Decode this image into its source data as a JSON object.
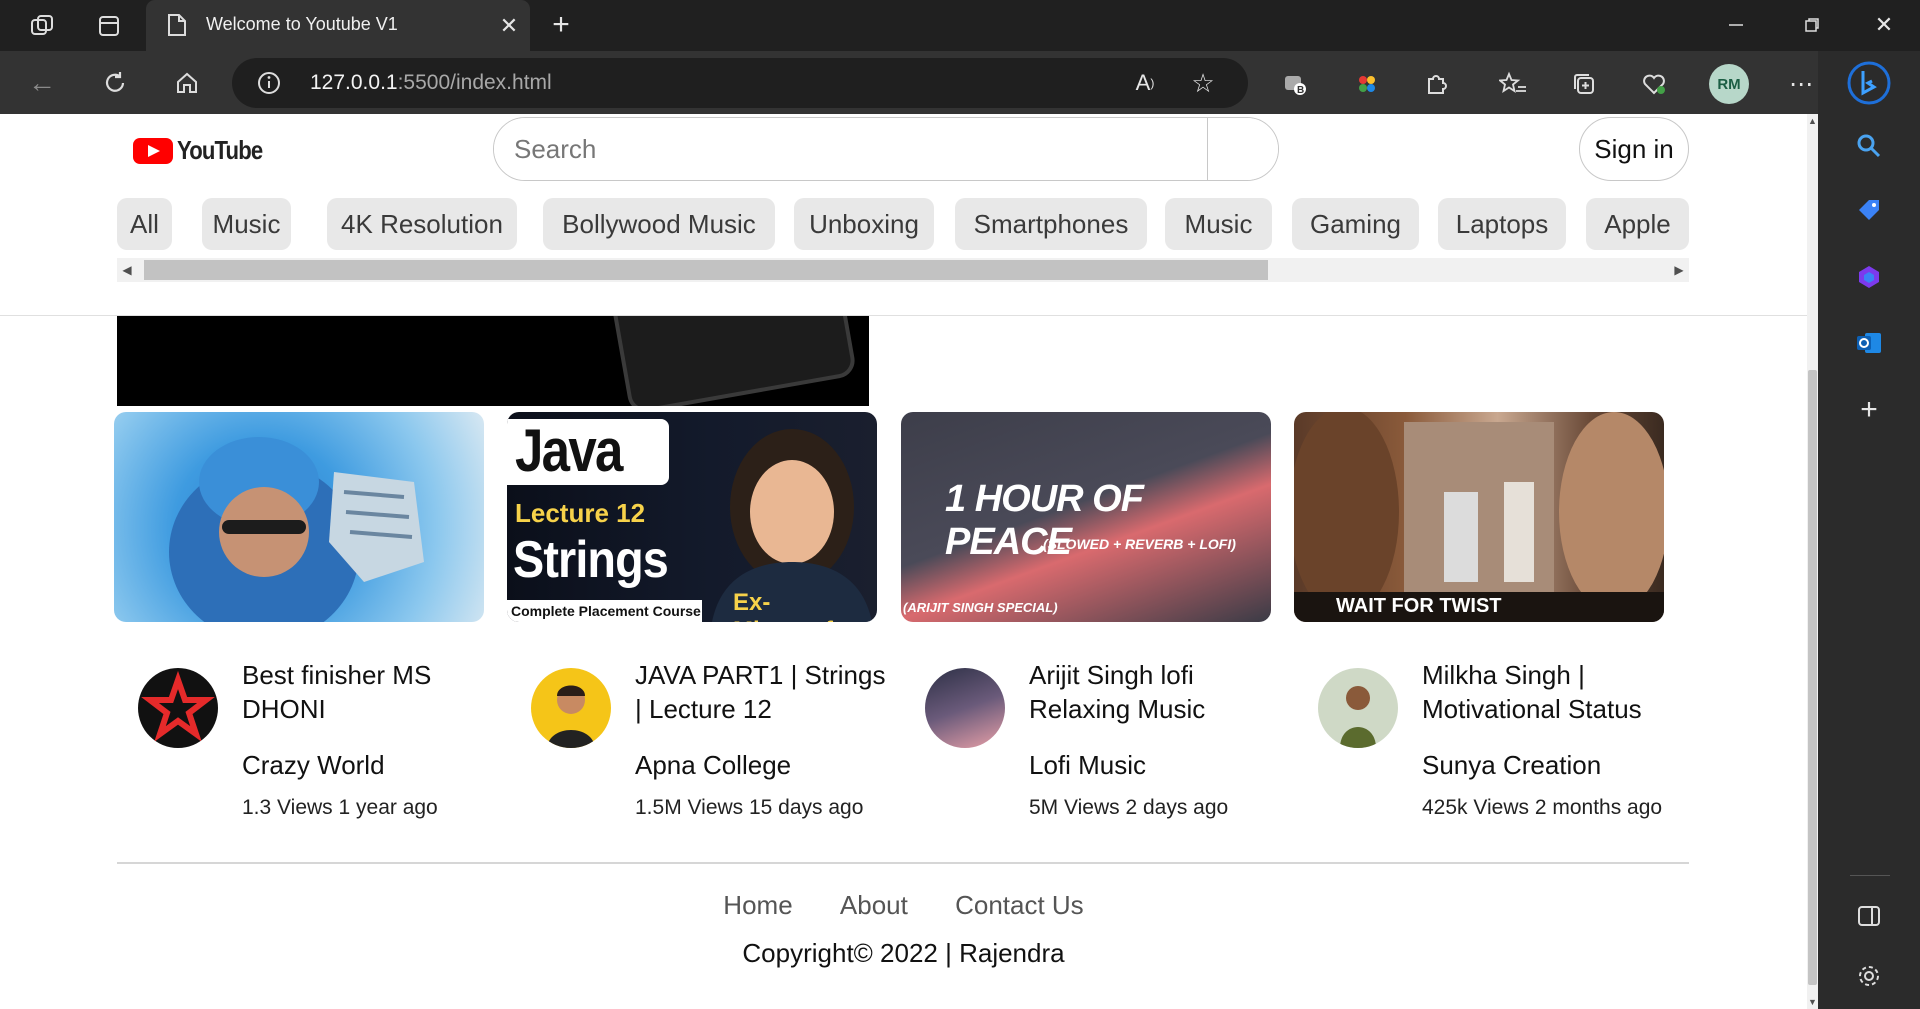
{
  "browser": {
    "tab_title": "Welcome to Youtube V1",
    "url_host": "127.0.0.1",
    "url_rest": ":5500/index.html",
    "profile_initials": "RM"
  },
  "header": {
    "logo_text": "YouTube",
    "search_placeholder": "Search",
    "signin_label": "Sign in"
  },
  "chips": [
    {
      "label": "All"
    },
    {
      "label": "Music"
    },
    {
      "label": "4K Resolution"
    },
    {
      "label": "Bollywood Music"
    },
    {
      "label": "Unboxing"
    },
    {
      "label": "Smartphones"
    },
    {
      "label": "Music"
    },
    {
      "label": "Gaming"
    },
    {
      "label": "Laptops"
    },
    {
      "label": "Apple"
    }
  ],
  "thumbnails": {
    "java_title": "Java",
    "java_lecture": "Lecture 12",
    "java_strings": "Strings",
    "java_course": "Complete Placement Course",
    "java_badge": "Ex-Microsoft",
    "lofi_title": "1 HOUR OF PEACE",
    "lofi_sub": "(SLOWED + REVERB + LOFI)",
    "lofi_tag": "(ARIJIT SINGH SPECIAL)",
    "milkha_text": "WAIT FOR TWIST"
  },
  "videos": [
    {
      "title": "Best finisher MS DHONI",
      "channel": "Crazy World",
      "stats": "1.3 Views 1 year ago"
    },
    {
      "title": "JAVA PART1 | Strings | Lecture 12",
      "channel": "Apna College",
      "stats": "1.5M Views 15 days ago"
    },
    {
      "title": "Arijit Singh lofi Relaxing Music",
      "channel": "Lofi Music",
      "stats": "5M Views 2 days ago"
    },
    {
      "title": "Milkha Singh | Motivational Status",
      "channel": "Sunya Creation",
      "stats": "425k Views 2 months ago"
    }
  ],
  "footer": {
    "links": [
      {
        "label": "Home"
      },
      {
        "label": "About"
      },
      {
        "label": "Contact Us"
      }
    ],
    "copyright": "Copyright© 2022 | Rajendra"
  }
}
